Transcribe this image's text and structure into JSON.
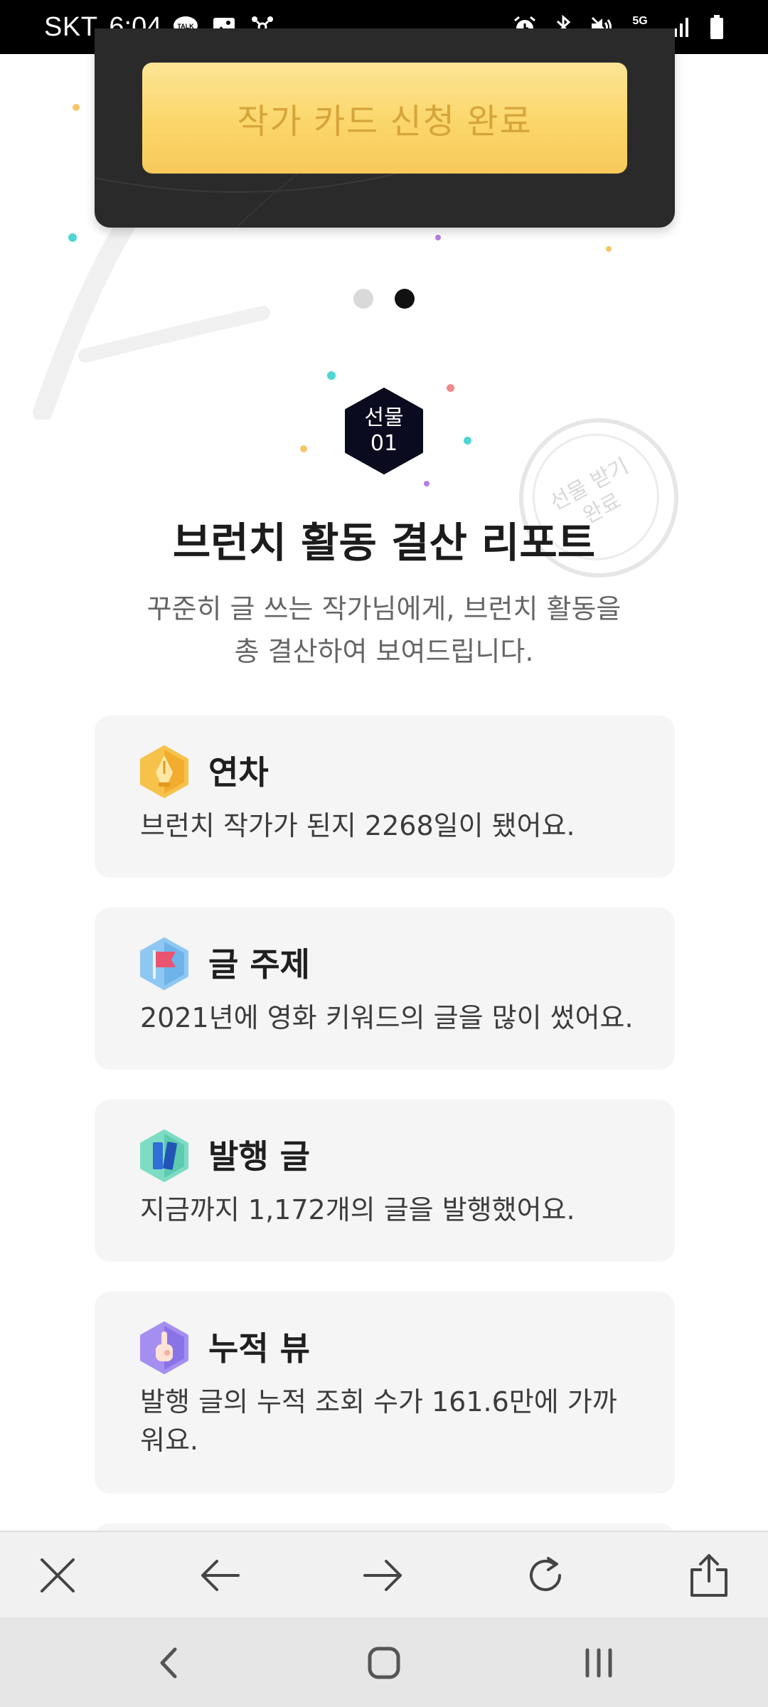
{
  "status_bar": {
    "carrier": "SKT",
    "time": "6:04",
    "network": "5G",
    "left_icons": [
      "talk-icon",
      "image-icon",
      "network-hub-icon"
    ],
    "right_icons": [
      "alarm-icon",
      "bluetooth-icon",
      "mute-icon",
      "5g-icon",
      "signal-icon",
      "battery-icon"
    ]
  },
  "top_card": {
    "apply_button_label": "작가 카드 신청 완료"
  },
  "pager": {
    "count": 2,
    "active_index": 1
  },
  "gift": {
    "badge_line1": "선물",
    "badge_line2": "01",
    "stamp_line1": "선물 받기",
    "stamp_line2": "완료"
  },
  "report": {
    "title": "브런치 활동 결산 리포트",
    "subtitle_line1": "꾸준히 글 쓰는 작가님에게, 브런치 활동을",
    "subtitle_line2": "총 결산하여 보여드립니다."
  },
  "cards": [
    {
      "icon": "pen-nib-icon",
      "heading": "연차",
      "body": "브런치 작가가 된지 2268일이 됐어요."
    },
    {
      "icon": "flag-icon",
      "heading": "글 주제",
      "body": "2021년에 영화 키워드의 글을 많이 썼어요."
    },
    {
      "icon": "books-icon",
      "heading": "발행 글",
      "body": "지금까지 1,172개의 글을 발행했어요."
    },
    {
      "icon": "hand-point-icon",
      "heading": "누적 뷰",
      "body": "발행 글의 누적 조회 수가 161.6만에 가까워요."
    }
  ],
  "browser_toolbar": {
    "items": [
      "close-icon",
      "back-arrow-icon",
      "forward-arrow-icon",
      "refresh-icon",
      "share-icon"
    ]
  },
  "system_nav": {
    "items": [
      "nav-back-icon",
      "nav-home-icon",
      "nav-recents-icon"
    ]
  },
  "colors": {
    "accent_yellow": "#fbd66a",
    "dark_card": "#2b2a2b",
    "badge_navy": "#0b0b1f",
    "card_bg": "#f5f5f5"
  }
}
